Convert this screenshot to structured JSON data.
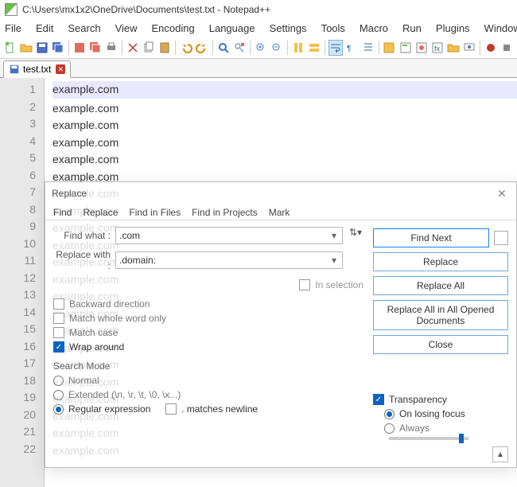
{
  "title": "C:\\Users\\mx1x2\\OneDrive\\Documents\\test.txt - Notepad++",
  "menu": [
    "File",
    "Edit",
    "Search",
    "View",
    "Encoding",
    "Language",
    "Settings",
    "Tools",
    "Macro",
    "Run",
    "Plugins",
    "Window",
    "?"
  ],
  "tab": {
    "label": "test.txt"
  },
  "lines": 22,
  "text_line": "example.com",
  "dialog": {
    "title": "Replace",
    "tabs": [
      "Find",
      "Replace",
      "Find in Files",
      "Find in Projects",
      "Mark"
    ],
    "find_label": "Find what :",
    "find_value": ".com",
    "replace_label": "Replace with :",
    "replace_value": ".domain:",
    "in_selection": "In selection",
    "backward": "Backward direction",
    "whole_word": "Match whole word only",
    "match_case": "Match case",
    "wrap": "Wrap around",
    "mode_title": "Search Mode",
    "mode_normal": "Normal",
    "mode_ext": "Extended (\\n, \\r, \\t, \\0, \\x...)",
    "mode_regex": "Regular expression",
    "matches_newline": ". matches newline",
    "buttons": {
      "find_next": "Find Next",
      "replace": "Replace",
      "replace_all": "Replace All",
      "replace_all_open": "Replace All in All Opened Documents",
      "close": "Close"
    },
    "transparency": {
      "label": "Transparency",
      "on_focus": "On losing focus",
      "always": "Always"
    }
  }
}
